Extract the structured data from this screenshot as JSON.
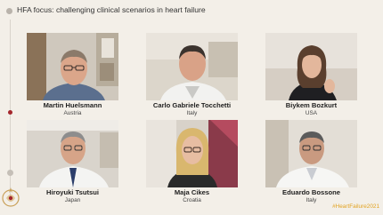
{
  "header": {
    "title": "HFA focus: challenging clinical scenarios in heart failure"
  },
  "participants": [
    {
      "name": "Martin Huelsmann",
      "country": "Austria"
    },
    {
      "name": "Carlo Gabriele Tocchetti",
      "country": "Italy"
    },
    {
      "name": "Biykem Bozkurt",
      "country": "USA"
    },
    {
      "name": "Hiroyuki Tsutsui",
      "country": "Japan"
    },
    {
      "name": "Maja Cikes",
      "country": "Croatia"
    },
    {
      "name": "Eduardo Bossone",
      "country": "Italy"
    }
  ],
  "footer": {
    "hashtag": "#HeartFailure2021"
  },
  "colors": {
    "background": "#f3efe8",
    "accent_red": "#a4262c",
    "hashtag": "#e2a322"
  }
}
